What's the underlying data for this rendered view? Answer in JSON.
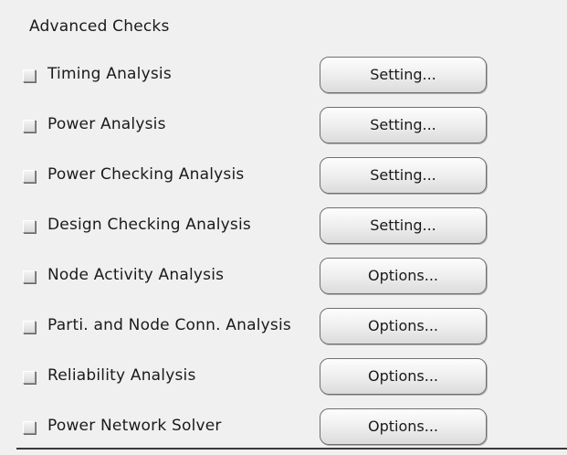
{
  "panel": {
    "title": "Advanced Checks"
  },
  "checks": [
    {
      "label": "Timing Analysis",
      "button": "Setting...",
      "checked": false
    },
    {
      "label": "Power Analysis",
      "button": "Setting...",
      "checked": false
    },
    {
      "label": "Power Checking Analysis",
      "button": "Setting...",
      "checked": false
    },
    {
      "label": "Design Checking Analysis",
      "button": "Setting...",
      "checked": false
    },
    {
      "label": "Node Activity Analysis",
      "button": "Options...",
      "checked": false
    },
    {
      "label": "Parti. and Node Conn. Analysis",
      "button": "Options...",
      "checked": false
    },
    {
      "label": "Reliability Analysis",
      "button": "Options...",
      "checked": false
    },
    {
      "label": "Power Network Solver",
      "button": "Options...",
      "checked": false
    }
  ]
}
